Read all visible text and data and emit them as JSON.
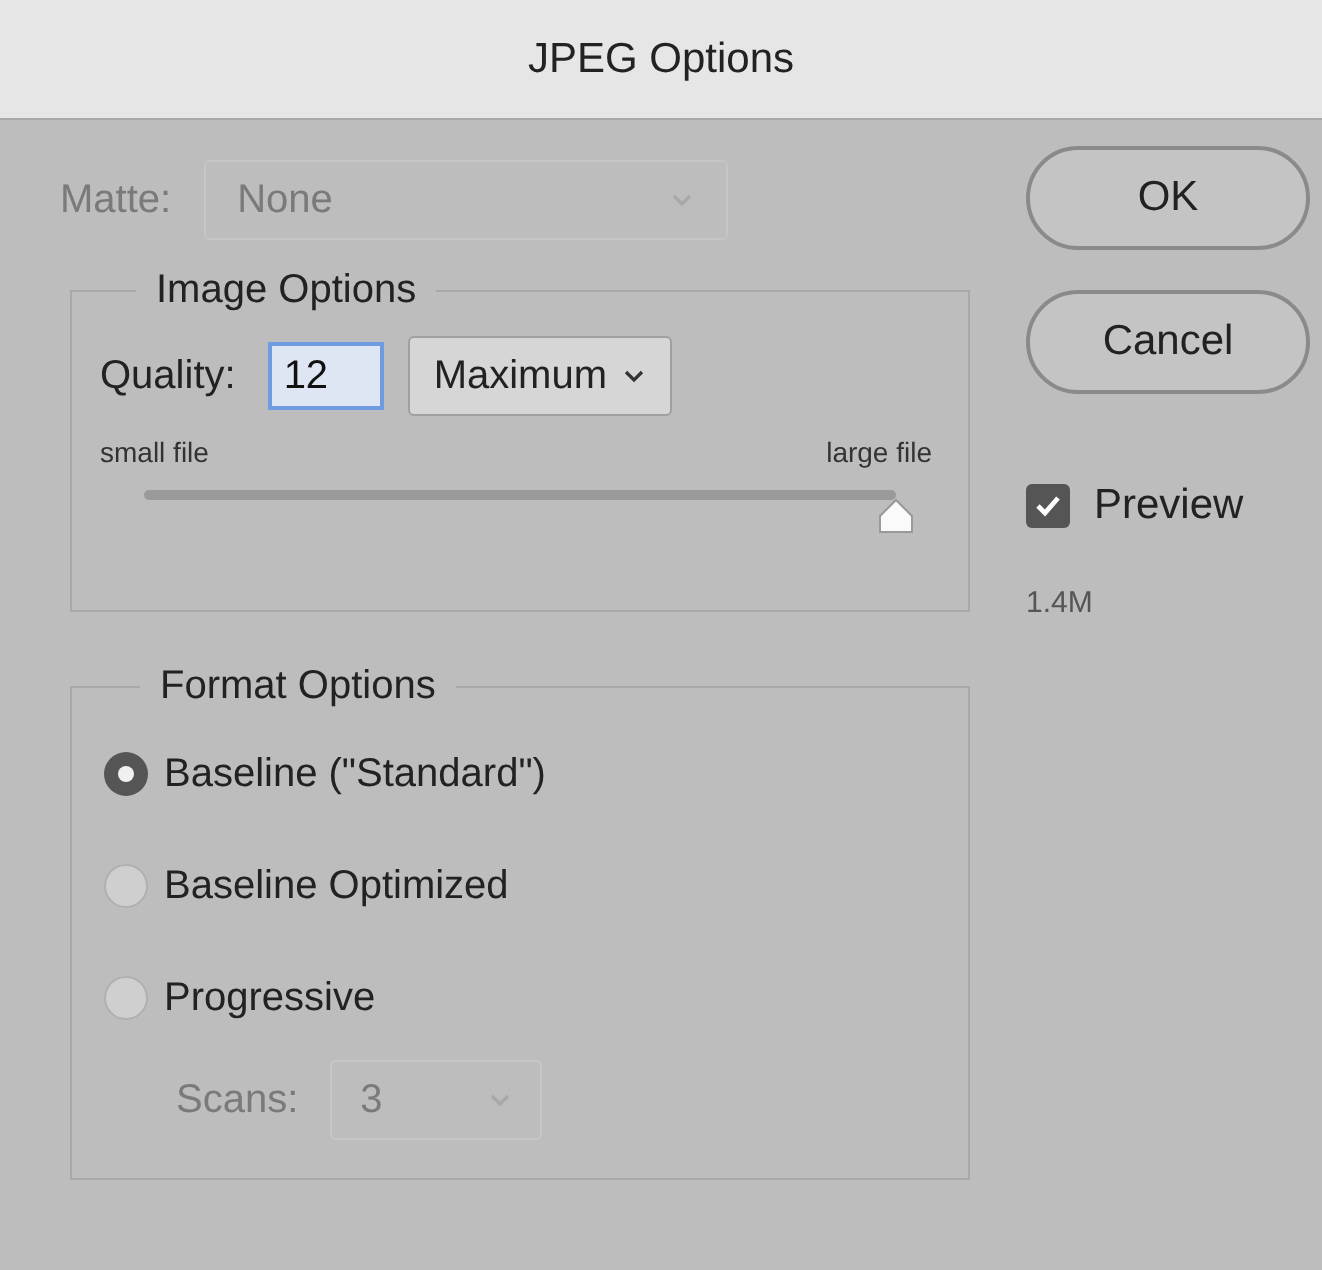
{
  "window": {
    "title": "JPEG Options"
  },
  "matte": {
    "label": "Matte:",
    "value": "None",
    "disabled": true
  },
  "image_options": {
    "title": "Image Options",
    "quality_label": "Quality:",
    "quality_value": "12",
    "quality_preset": "Maximum",
    "slider": {
      "min_label": "small file",
      "max_label": "large file",
      "level": 1
    }
  },
  "format_options": {
    "title": "Format Options",
    "options": [
      {
        "label": "Baseline (\"Standard\")",
        "selected": true
      },
      {
        "label": "Baseline Optimized",
        "selected": false
      },
      {
        "label": "Progressive",
        "selected": false
      }
    ],
    "scans": {
      "label": "Scans:",
      "value": "3",
      "disabled": true
    }
  },
  "buttons": [
    {
      "label": "OK"
    },
    {
      "label": "Cancel"
    }
  ],
  "preview": {
    "label": "Preview",
    "checked": true
  },
  "file_size": "1.4M"
}
